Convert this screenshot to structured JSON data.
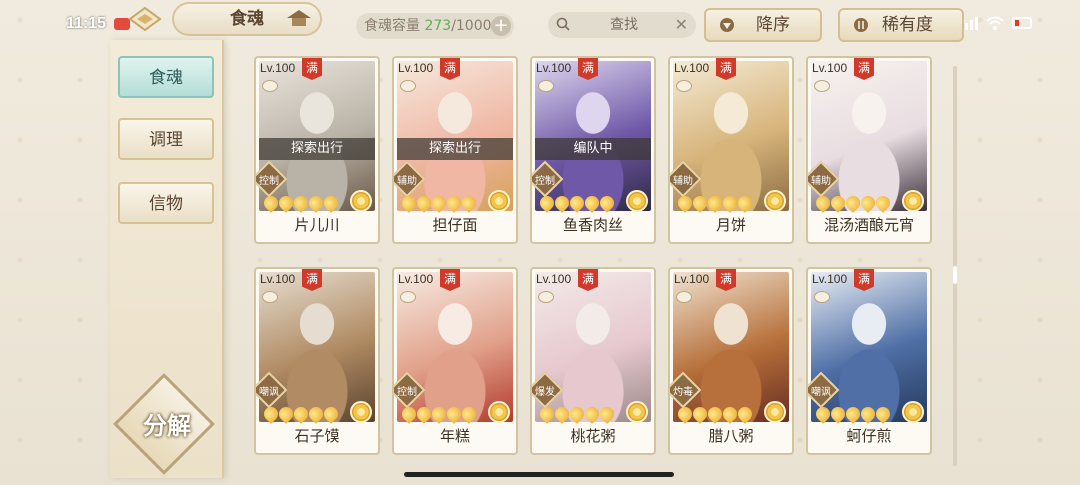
{
  "status_bar": {
    "time": "11:15",
    "network": "4G"
  },
  "header": {
    "title": "食魂",
    "capacity_label": "食魂容量",
    "capacity_current": "273",
    "capacity_max": "/1000",
    "search_label": "查找",
    "sort_order_label": "降序",
    "sort_key_label": "稀有度"
  },
  "sidebar": {
    "items": [
      {
        "label": "食魂",
        "active": true
      },
      {
        "label": "调理",
        "active": false
      },
      {
        "label": "信物",
        "active": false
      }
    ],
    "decompose_label": "分解"
  },
  "cards": [
    {
      "level": "Lv.100",
      "full": "满",
      "status": "探索出行",
      "role": "控制",
      "name": "片儿川",
      "stars": 5,
      "palette": [
        "#e9e4dc",
        "#b9b2a6",
        "#6c5a48"
      ]
    },
    {
      "level": "Lv.100",
      "full": "满",
      "status": "探索出行",
      "role": "辅助",
      "name": "担仔面",
      "stars": 5,
      "palette": [
        "#f5e9dd",
        "#f0b7a4",
        "#d5a25a"
      ]
    },
    {
      "level": "Lv.100",
      "full": "满",
      "status": "编队中",
      "role": "控制",
      "name": "鱼香肉丝",
      "stars": 5,
      "palette": [
        "#ddd6ee",
        "#6f58a8",
        "#2f2b45"
      ]
    },
    {
      "level": "Lv.100",
      "full": "满",
      "status": "",
      "role": "辅助",
      "name": "月饼",
      "stars": 5,
      "palette": [
        "#f4ead6",
        "#d7b47a",
        "#8d6d45"
      ]
    },
    {
      "level": "Lv.100",
      "full": "满",
      "status": "",
      "role": "辅助",
      "name": "混汤酒酿元宵",
      "stars": 5,
      "palette": [
        "#f7f2ee",
        "#e8dde1",
        "#3b2f3a"
      ]
    },
    {
      "level": "Lv.100",
      "full": "满",
      "status": "",
      "role": "嘲讽",
      "name": "石子馍",
      "stars": 5,
      "palette": [
        "#e6ddd0",
        "#b08b63",
        "#5b4430"
      ]
    },
    {
      "level": "Lv.100",
      "full": "满",
      "status": "",
      "role": "控制",
      "name": "年糕",
      "stars": 5,
      "palette": [
        "#f7ebe3",
        "#e1a08a",
        "#b33b2e"
      ]
    },
    {
      "level": "Lv.100",
      "full": "满",
      "status": "",
      "role": "爆发",
      "name": "桃花粥",
      "stars": 5,
      "palette": [
        "#f2ebe8",
        "#e7c8cf",
        "#9b8a88"
      ]
    },
    {
      "level": "Lv.100",
      "full": "满",
      "status": "",
      "role": "灼毒",
      "name": "腊八粥",
      "stars": 5,
      "palette": [
        "#efe2d0",
        "#b7703b",
        "#6a2e22"
      ]
    },
    {
      "level": "Lv.100",
      "full": "满",
      "status": "",
      "role": "嘲讽",
      "name": "蚵仔煎",
      "stars": 5,
      "palette": [
        "#e8edf3",
        "#4f6fa6",
        "#263a5c"
      ]
    }
  ],
  "colors": {
    "accent_teal": "#b5ddd7",
    "capacity_green": "#5fae59",
    "full_badge": "#cf3a2a"
  },
  "icons": [
    "home-icon",
    "roof-icon",
    "plus-icon",
    "search-icon",
    "clear-icon",
    "sort-desc-icon",
    "sort-key-icon",
    "bowl-icon",
    "flower-icon"
  ]
}
